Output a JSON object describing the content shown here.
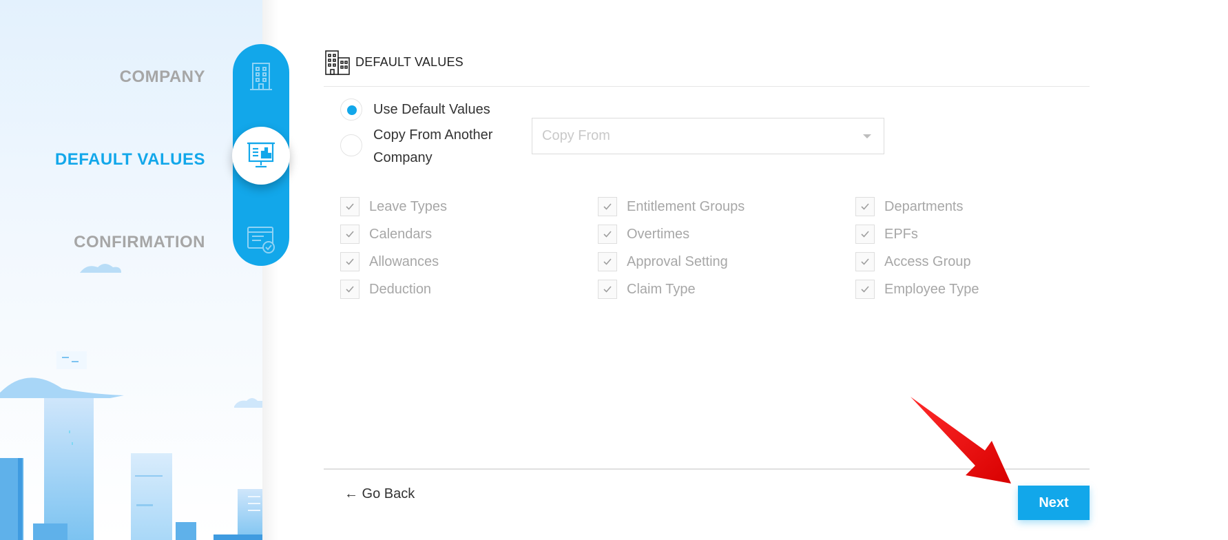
{
  "sidebar": {
    "steps": [
      {
        "label": "COMPANY",
        "icon": "building-icon",
        "active": false
      },
      {
        "label": "DEFAULT VALUES",
        "icon": "presentation-board-icon",
        "active": true
      },
      {
        "label": "CONFIRMATION",
        "icon": "certificate-check-icon",
        "active": false
      }
    ]
  },
  "main": {
    "section_title": "DEFAULT VALUES",
    "section_icon": "buildings-icon",
    "options": [
      {
        "label": "Use Default Values",
        "checked": true
      },
      {
        "label": "Copy From Another Company",
        "checked": false
      }
    ],
    "copy_from": {
      "placeholder": "Copy From",
      "value": ""
    },
    "checkboxes": [
      [
        "Leave Types",
        "Calendars",
        "Allowances",
        "Deduction"
      ],
      [
        "Entitlement Groups",
        "Overtimes",
        "Approval Setting",
        "Claim Type"
      ],
      [
        "Departments",
        "EPFs",
        "Access Group",
        "Employee Type"
      ]
    ]
  },
  "footer": {
    "back_label": "← Go Back",
    "next_label": "Next"
  },
  "colors": {
    "accent": "#12a7ea",
    "inactive_step": "#a6a6a6",
    "annotation_arrow": "#ee1111"
  }
}
